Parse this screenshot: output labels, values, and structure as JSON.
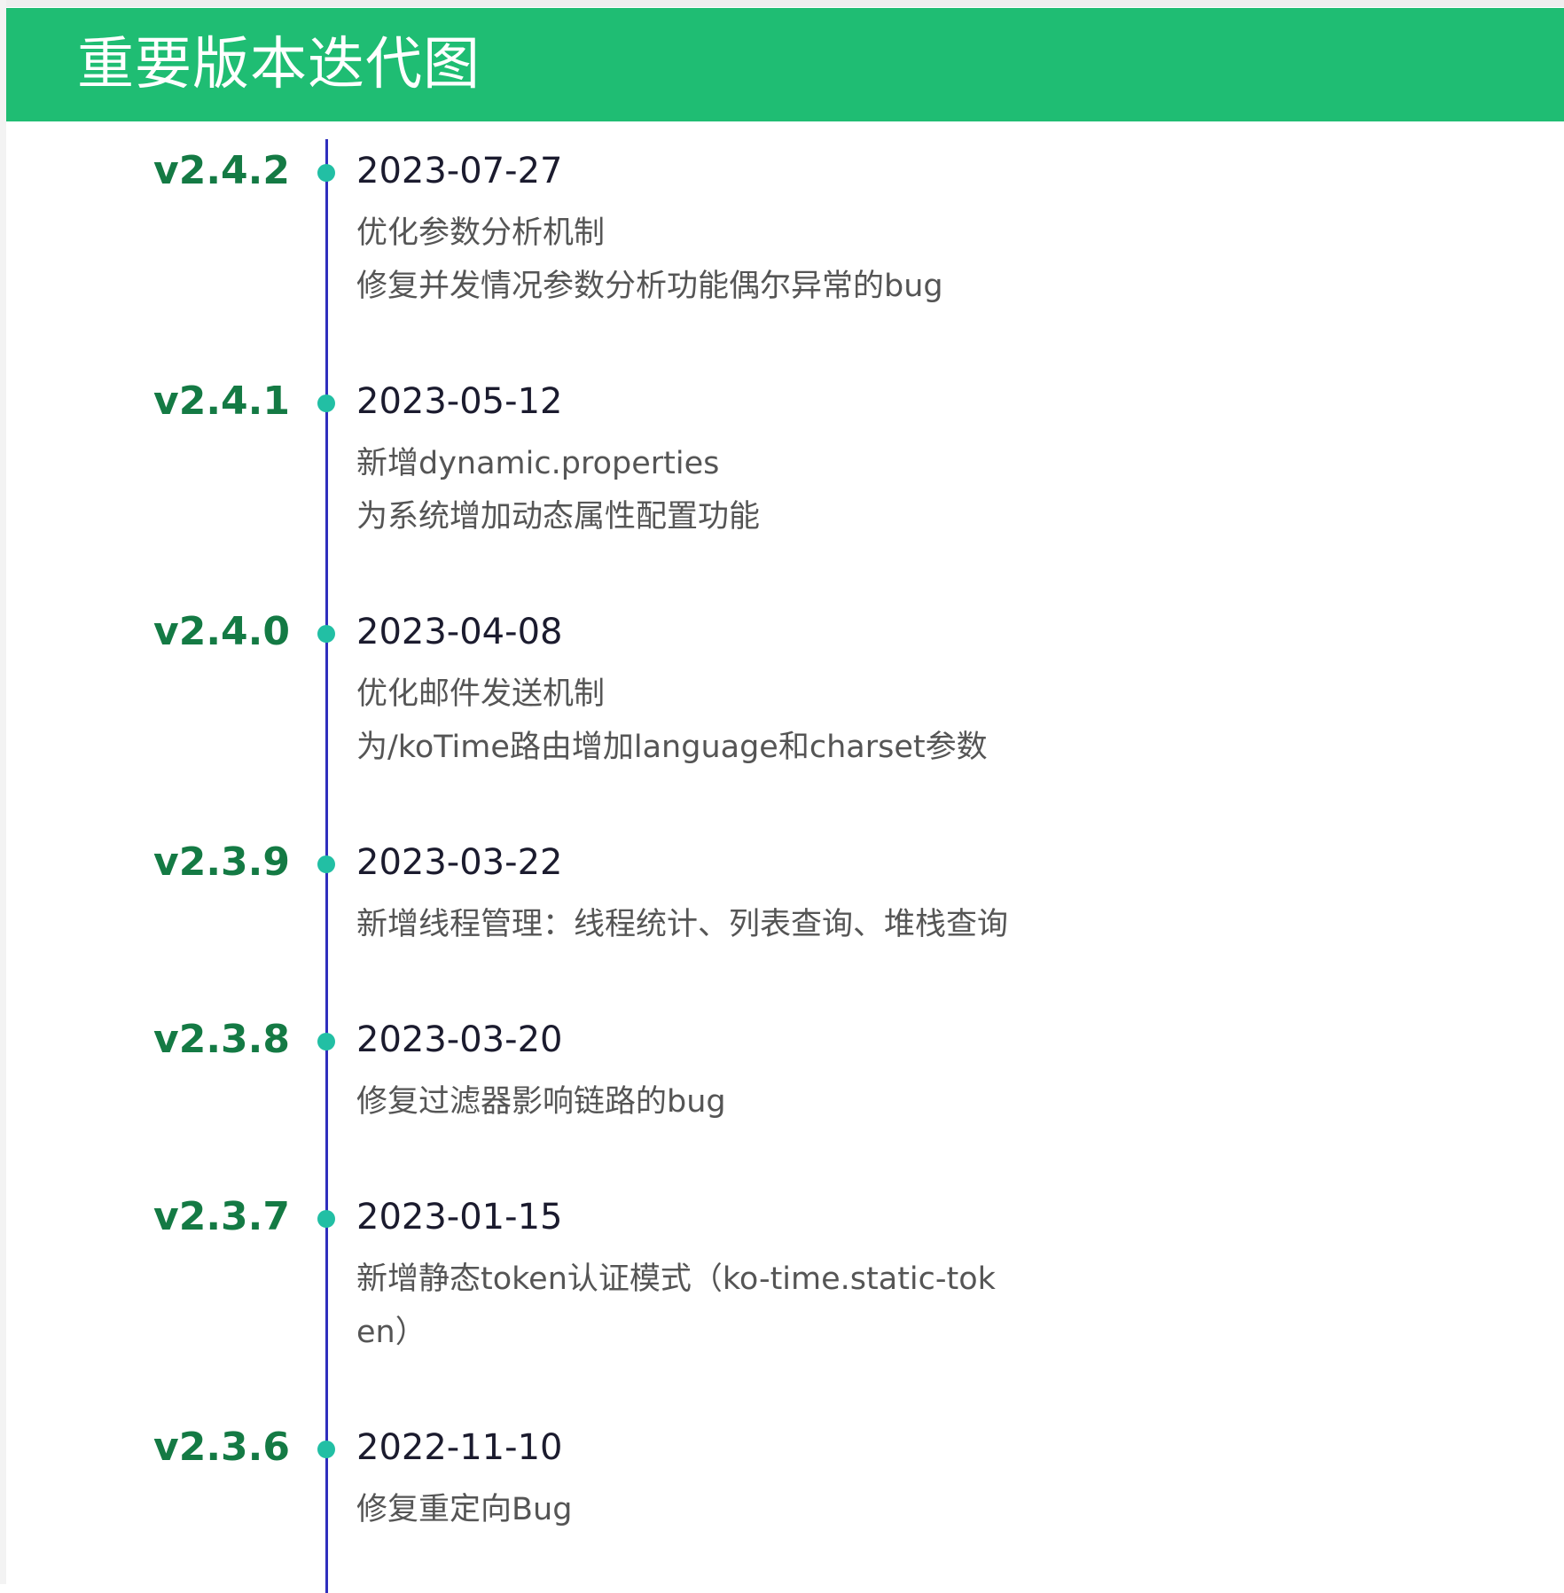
{
  "header": {
    "title": "重要版本迭代图"
  },
  "colors": {
    "header_bg": "#1fbd73",
    "version_text": "#147a44",
    "timeline_line": "#2f2fbd",
    "timeline_dot": "#22bfa4"
  },
  "entries": [
    {
      "version": "v2.4.2",
      "date": "2023-07-27",
      "notes": [
        "优化参数分析机制",
        "修复并发情况参数分析功能偶尔异常的bug"
      ]
    },
    {
      "version": "v2.4.1",
      "date": "2023-05-12",
      "notes": [
        "新增dynamic.properties",
        "为系统增加动态属性配置功能"
      ]
    },
    {
      "version": "v2.4.0",
      "date": "2023-04-08",
      "notes": [
        "优化邮件发送机制",
        "为/koTime路由增加language和charset参数"
      ]
    },
    {
      "version": "v2.3.9",
      "date": "2023-03-22",
      "notes": [
        "新增线程管理：线程统计、列表查询、堆栈查询"
      ]
    },
    {
      "version": "v2.3.8",
      "date": "2023-03-20",
      "notes": [
        "修复过滤器影响链路的bug"
      ]
    },
    {
      "version": "v2.3.7",
      "date": "2023-01-15",
      "notes": [
        "新增静态token认证模式（ko-time.static-token）"
      ]
    },
    {
      "version": "v2.3.6",
      "date": "2022-11-10",
      "notes": [
        "修复重定向Bug"
      ]
    }
  ]
}
